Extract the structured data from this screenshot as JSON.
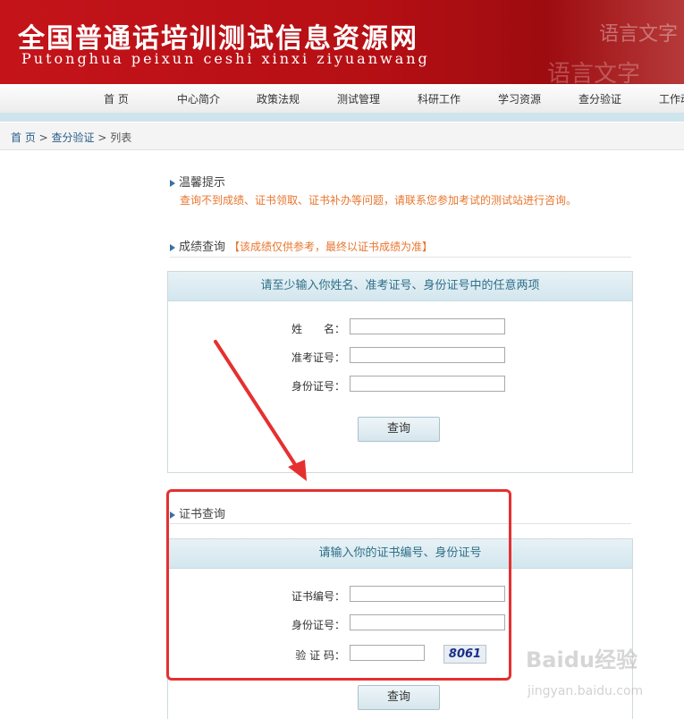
{
  "header": {
    "title": "全国普通话培训测试信息资源网",
    "subtitle": "Putonghua peixun ceshi xinxi ziyuanwang",
    "watermark_top": "语言文字",
    "watermark_bottom": "语言文字"
  },
  "nav": {
    "items": [
      "首 页",
      "中心简介",
      "政策法规",
      "测试管理",
      "科研工作",
      "学习资源",
      "查分验证",
      "工作动"
    ]
  },
  "breadcrumb": {
    "home": "首 页",
    "sep1": " > ",
    "section": "查分验证",
    "sep2": " > ",
    "current": "列表"
  },
  "tips": {
    "heading": "温馨提示",
    "text": "查询不到成绩、证书领取、证书补办等问题，请联系您参加考试的测试站进行咨询。"
  },
  "score_query": {
    "heading": "成绩查询",
    "note": "【该成绩仅供参考，最终以证书成绩为准】",
    "panel_title": "请至少输入你姓名、准考证号、身份证号中的任意两项",
    "name_label": "姓　　名：",
    "exam_no_label": "准考证号：",
    "id_label": "身份证号：",
    "name_value": "",
    "exam_no_value": "",
    "id_value": "",
    "submit_label": "查询"
  },
  "cert_query": {
    "heading": "证书查询",
    "panel_title": "请输入你的证书编号、身份证号",
    "cert_no_label": "证书编号：",
    "id_label": "身份证号：",
    "captcha_label": "验 证 码：",
    "cert_no_value": "",
    "id_value": "",
    "captcha_value": "",
    "captcha_image_text": "8061",
    "submit_label": "查询"
  },
  "watermark": {
    "brand": "Baidu经验",
    "url": "jingyan.baidu.com"
  },
  "colors": {
    "banner_red": "#c4141a",
    "accent_orange": "#e8762e",
    "panel_title_blue": "#2e6f88",
    "annotation_red": "#e53030"
  }
}
